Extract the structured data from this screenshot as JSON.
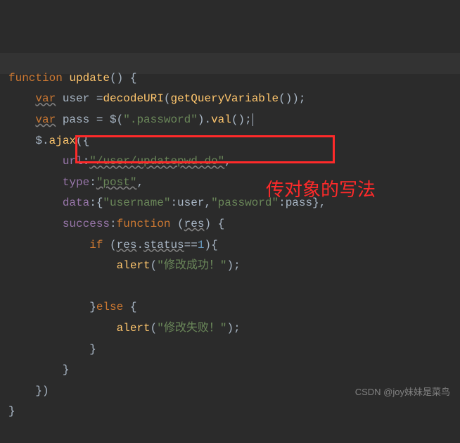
{
  "code": {
    "l1": {
      "kw_function": "function",
      "fn_name": "update",
      "parens": "()",
      "brace": " {"
    },
    "l2": {
      "kw_var": "var",
      "v": " user ",
      "eq": "=",
      "fn1": "decodeURI",
      "p1": "(",
      "fn2": "getQueryVariable",
      "p2": "());"
    },
    "l3": {
      "kw_var": "var",
      "v": " pass ",
      "eq": "= ",
      "jq": "$(",
      "str": "\".password\"",
      "rest": ").",
      "val": "val",
      "tail": "();"
    },
    "l4": {
      "jq": "$.",
      "ajax": "ajax",
      "p": "({"
    },
    "l5": {
      "prop": "url",
      "colon": ":",
      "str": "\"/user/updatepwd.do\"",
      "comma": ","
    },
    "l6": {
      "prop": "type",
      "colon": ":",
      "str": "\"post\"",
      "comma": ","
    },
    "l7": {
      "prop": "data",
      "colon": ":{",
      "k1": "\"username\"",
      "c1": ":",
      "v1": "user",
      "sep": ",",
      "k2": "\"password\"",
      "c2": ":",
      "v2": "pass",
      "close": "},"
    },
    "l8": {
      "prop": "success",
      "colon": ":",
      "kw_function": "function",
      "paren_open": " (",
      "param": "res",
      "paren_close": ") {"
    },
    "l9": {
      "kw_if": "if",
      "p1": " (",
      "obj": "res",
      "dot": ".",
      "prop": "status",
      "eq": "==",
      "num": "1",
      "p2": "){"
    },
    "l10": {
      "fn": "alert",
      "p1": "(",
      "str": "\"修改成功！\"",
      "p2": ");"
    },
    "l11": {
      "txt": ""
    },
    "l12": {
      "close": "}",
      "kw_else": "else",
      "brace": " {"
    },
    "l13": {
      "fn": "alert",
      "p1": "(",
      "str": "\"修改失败！\"",
      "p2": ");"
    },
    "l14": {
      "close": "}"
    },
    "l15": {
      "close": "}"
    },
    "l16": {
      "close": "})"
    },
    "l17": {
      "close": "}"
    }
  },
  "annotation": "传对象的写法",
  "watermark": "CSDN @joy妹妹是菜鸟"
}
